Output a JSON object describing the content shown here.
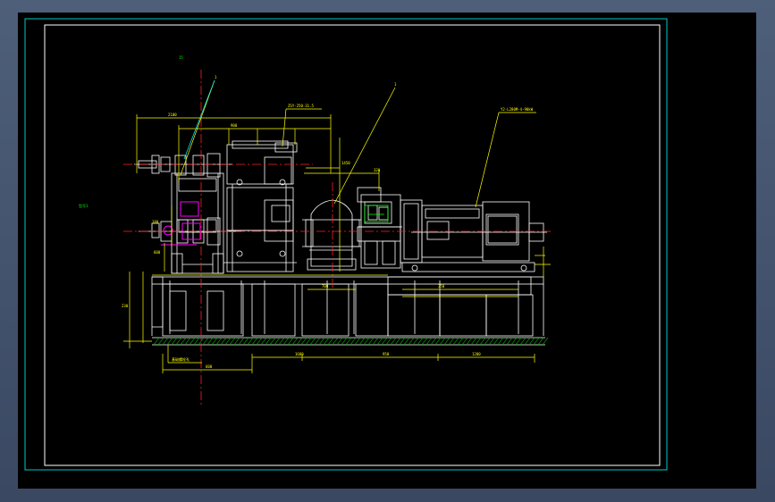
{
  "drawing": {
    "labels": {
      "grid_mark": "15",
      "side_note": "型号1",
      "leader_1_num": "1",
      "leader_2_num": "1",
      "motor_callout": "Y2-L280M-4-90kW",
      "gear_callout": "ZSY-250-31.5",
      "foundation_note": "基础螺栓孔",
      "dim_top": "2100",
      "dim_roll": "900",
      "dim_h1": "1450",
      "dim_h2": "320",
      "dim_b1": "600",
      "dim_b2": "1680",
      "dim_b3": "950",
      "dim_b4": "1200",
      "dim_b5": "700",
      "dim_bottom": "350",
      "dim_left_1": "230",
      "dim_left_2": "180",
      "dim_left_3": "600"
    },
    "colors": {
      "background": "#000000",
      "frame": "#ffffff",
      "outer_frame": "#00c8c8",
      "machine": "#ffffff",
      "dimension": "#ffff00",
      "centerline": "#ff2020",
      "highlight": "#ff00ff",
      "annotation": "#00ff00",
      "hatch": "#00a000",
      "leader": "#00ffff"
    }
  }
}
